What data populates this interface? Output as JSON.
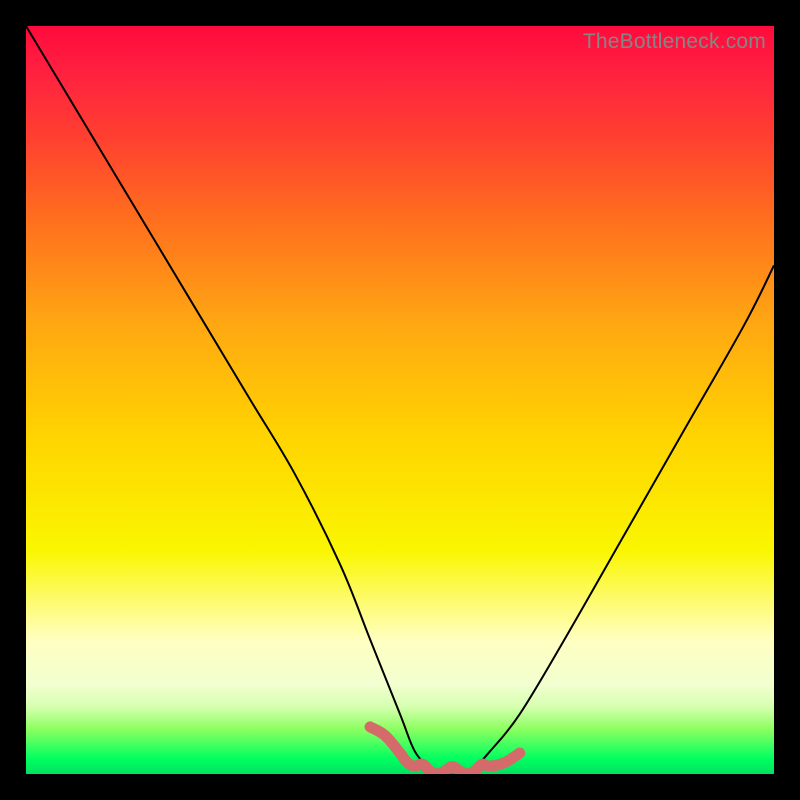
{
  "watermark": {
    "text": "TheBottleneck.com"
  },
  "colors": {
    "frame": "#000000",
    "curve_primary": "#000000",
    "curve_accent": "#d46a6a",
    "gradient_top": "#ff0a3c",
    "gradient_bottom": "#00e060"
  },
  "chart_data": {
    "type": "line",
    "title": "",
    "xlabel": "",
    "ylabel": "",
    "xlim": [
      0,
      100
    ],
    "ylim": [
      0,
      100
    ],
    "series": [
      {
        "name": "bottleneck-curve",
        "x": [
          0,
          6,
          12,
          18,
          24,
          30,
          36,
          42,
          46,
          50,
          52,
          54,
          56,
          58,
          60,
          62,
          66,
          72,
          80,
          88,
          96,
          100
        ],
        "y": [
          100,
          90,
          80,
          70,
          60,
          50,
          40,
          28,
          18,
          8,
          3,
          1,
          0,
          0,
          1,
          3,
          8,
          18,
          32,
          46,
          60,
          68
        ]
      }
    ],
    "annotations": [
      {
        "name": "accent-trough",
        "x_range": [
          46,
          66
        ],
        "style": "thick-pink"
      }
    ],
    "grid": false,
    "legend": false
  }
}
